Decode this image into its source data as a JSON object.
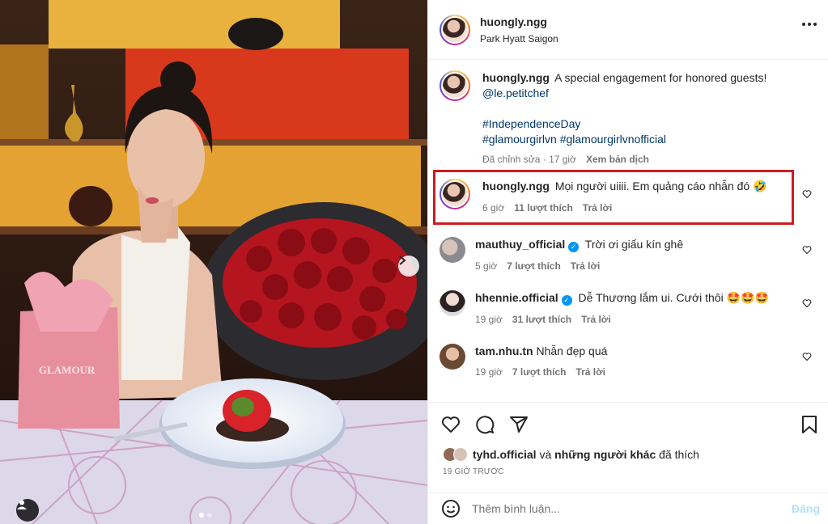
{
  "post": {
    "author": "huongly.ngg",
    "location": "Park Hyatt Saigon",
    "caption": {
      "text": "A special engagement for honored guests!",
      "mention": "@le.petitchef",
      "hashtag_line1": "#IndependenceDay",
      "hashtag_line2": "#glamourgirlvn #glamourgirlvnofficial",
      "edited": "Đã chỉnh sửa · 17 giờ",
      "translate": "Xem bản dịch"
    },
    "photo": {
      "bag_text": "GLAMOUR"
    }
  },
  "comments": [
    {
      "user": "huongly.ngg",
      "text": "Mọi người uiiii. Em quảng cáo nhẫn đó 🤣",
      "time": "6 giờ",
      "likes": "11 lượt thích",
      "reply": "Trả lời",
      "verified": false
    },
    {
      "user": "mauthuy_official",
      "text": "Trời ơi giấu kín ghê",
      "time": "5 giờ",
      "likes": "7 lượt thích",
      "reply": "Trả lời",
      "verified": true
    },
    {
      "user": "hhennie.official",
      "text": "Dễ Thương lắm ui. Cưới thôi 🤩🤩🤩",
      "time": "19 giờ",
      "likes": "31 lượt thích",
      "reply": "Trả lời",
      "verified": true
    },
    {
      "user": "tam.nhu.tn",
      "text": "Nhẫn đẹp quá",
      "time": "19 giờ",
      "likes": "7 lượt thích",
      "reply": "Trả lời",
      "verified": false
    }
  ],
  "liked_by": {
    "user": "tyhd.official",
    "rest": "và",
    "others": "những người khác",
    "suffix": "đã thích"
  },
  "posted_ago": "19 GIỜ TRƯỚC",
  "add_comment": {
    "placeholder": "Thêm bình luận...",
    "post_label": "Đăng"
  },
  "icons": [
    "more-horizontal-icon",
    "heart-icon",
    "comment-icon",
    "share-icon",
    "bookmark-icon",
    "emoji-icon",
    "chevron-right-icon",
    "user-tag-icon",
    "verified-icon"
  ],
  "colors": {
    "highlight_box": "#d11b20",
    "verified": "#0095f6",
    "link": "#00376b"
  }
}
